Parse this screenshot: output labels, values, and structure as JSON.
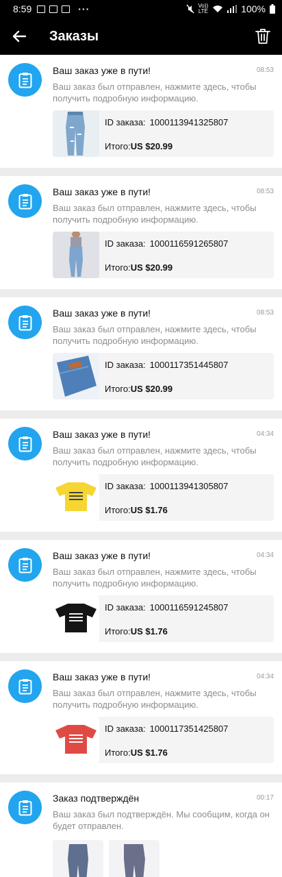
{
  "statusbar": {
    "time": "8:59",
    "battery": "100%",
    "volte": "Vo))",
    "lte": "LTE"
  },
  "header": {
    "title": "Заказы"
  },
  "notifications": [
    {
      "title": "Ваш заказ уже в пути!",
      "time": "08:53",
      "description": "Ваш заказ был отправлен, нажмите здесь, чтобы получить подробную информацию.",
      "order_id_label": "ID заказа:",
      "order_id": "1000113941325807",
      "total_label": "Итого:",
      "total": "US $20.99",
      "product": "jeans-ripped"
    },
    {
      "title": "Ваш заказ уже в пути!",
      "time": "08:53",
      "description": "Ваш заказ был отправлен, нажмите здесь, чтобы получить подробную информацию.",
      "order_id_label": "ID заказа:",
      "order_id": "1000116591265807",
      "total_label": "Итого:",
      "total": "US $20.99",
      "product": "jeans-model"
    },
    {
      "title": "Ваш заказ уже в пути!",
      "time": "08:53",
      "description": "Ваш заказ был отправлен, нажмите здесь, чтобы получить подробную информацию.",
      "order_id_label": "ID заказа:",
      "order_id": "1000117351445807",
      "total_label": "Итого:",
      "total": "US $20.99",
      "product": "jeans-folded"
    },
    {
      "title": "Ваш заказ уже в пути!",
      "time": "04:34",
      "description": "Ваш заказ был отправлен, нажмите здесь, чтобы получить подробную информацию.",
      "order_id_label": "ID заказа:",
      "order_id": "1000113941305807",
      "total_label": "Итого:",
      "total": "US $1.76",
      "product": "tshirt-yellow"
    },
    {
      "title": "Ваш заказ уже в пути!",
      "time": "04:34",
      "description": "Ваш заказ был отправлен, нажмите здесь, чтобы получить подробную информацию.",
      "order_id_label": "ID заказа:",
      "order_id": "1000116591245807",
      "total_label": "Итого:",
      "total": "US $1.76",
      "product": "tshirt-black"
    },
    {
      "title": "Ваш заказ уже в пути!",
      "time": "04:34",
      "description": "Ваш заказ был отправлен, нажмите здесь, чтобы получить подробную информацию.",
      "order_id_label": "ID заказа:",
      "order_id": "1000117351425807",
      "total_label": "Итого:",
      "total": "US $1.76",
      "product": "tshirt-red"
    },
    {
      "title": "Заказ подтверждён",
      "time": "00:17",
      "description": "Ваш заказ был подтверждён. Мы сообщим, когда он будет отправлен.",
      "products": [
        "leggings",
        "leggings"
      ]
    }
  ],
  "colors": {
    "accent": "#22a5ee",
    "bar": "#000000",
    "divider": "#ececec"
  }
}
